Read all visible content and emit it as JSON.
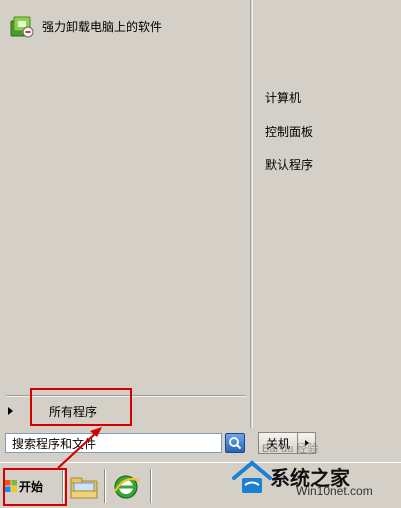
{
  "start_menu": {
    "pinned_programs": [
      {
        "label": "强力卸载电脑上的软件",
        "icon": "uninstall-program-icon"
      }
    ],
    "all_programs_label": "所有程序",
    "search": {
      "value": "搜索程序和文件",
      "placeholder": "搜索程序和文件"
    },
    "right_items": [
      {
        "label": "计算机"
      },
      {
        "label": "控制面板"
      },
      {
        "label": "默认程序"
      }
    ],
    "shutdown_label": "关机"
  },
  "taskbar": {
    "start_label": "开始",
    "pinned": [
      {
        "icon": "windows-explorer-icon"
      },
      {
        "icon": "internet-explorer-icon"
      }
    ]
  },
  "watermark": {
    "brand": "系统之家",
    "site": "Win10net.com",
    "baidu_text": "Bai du 经验"
  },
  "colors": {
    "highlight_box": "#d40000",
    "menu_bg": "#d4d0c8"
  }
}
